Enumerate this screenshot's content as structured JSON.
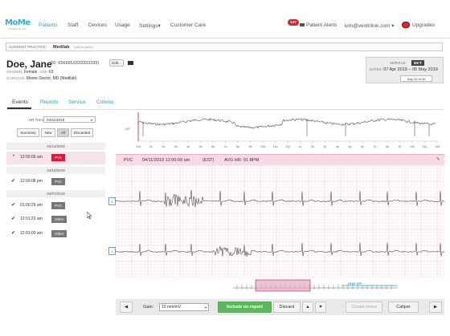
{
  "nav": {
    "logo": "MoMe",
    "logo_sub": "INFOBIONIC INC",
    "items": [
      "Patients",
      "Staff",
      "Devices",
      "Usage",
      "Settings",
      "Customer Care"
    ],
    "settings_caret": "▾",
    "alerts_count": "147",
    "alerts_label": "Patient Alerts",
    "user_email": "kim@ventrilink.com",
    "user_caret": "▾",
    "upgrades_label": "Upgrades"
  },
  "practice": {
    "label": "CURRENT PRACTICE:",
    "value": "Medilab",
    "hint": "(click to switch)"
  },
  "patient": {
    "name": "Doe, Jane",
    "id_text": "(ID: 6566653333333333)",
    "edit_label": "Edit...",
    "gender_label": "GENDER:",
    "gender": "Female",
    "age_label": "AGE:",
    "age": "63",
    "clinician_label": "CLINICIAN:",
    "clinician": "Moore Doctor, MD (Medilab)"
  },
  "service": {
    "label": "SERVICE:",
    "type": "MCT",
    "dates_label": "DATES:",
    "dates": "07 Apr 2019 – 05 May 2019",
    "day": "Day 10 of 30"
  },
  "tabs": [
    "Events",
    "Reports",
    "Service",
    "Criteria"
  ],
  "left": {
    "hr_trend_label": "HR Trend:",
    "hr_trend_value": "04/11/2019",
    "filters": [
      "Summary",
      "New",
      "All",
      "Discarded"
    ],
    "groups": [
      {
        "date": "04/11/2019",
        "events": [
          {
            "time": "12:00:09 am",
            "tag": "PVC"
          }
        ]
      },
      {
        "date": "04/10/2019",
        "events": [
          {
            "time": "12:00:08 pm",
            "tag": "PVC"
          }
        ]
      },
      {
        "date": "04/07/2019",
        "events": [
          {
            "time": "01:00:29 am",
            "tag": "PVC"
          },
          {
            "time": "12:01:23 am",
            "tag": "Other"
          },
          {
            "time": "12:01:00 am",
            "tag": "Other"
          }
        ]
      }
    ]
  },
  "trend": {
    "ylabel": "HR",
    "x_ticks": [
      "12a",
      "1a",
      "2a",
      "3a",
      "4a",
      "5a",
      "6a",
      "7a",
      "8a",
      "9a",
      "10a",
      "11a",
      "12p",
      "1p",
      "2p",
      "3p",
      "4p",
      "5p",
      "6p",
      "7p",
      "8p",
      "9p",
      "10p",
      "11p",
      "12a"
    ]
  },
  "strip": {
    "type": "PVC",
    "timestamp": "04/11/2019 12:00:09 am",
    "tz": "(EST)",
    "avg_hr": "AVG HR: 91 BPM",
    "lead1": "1",
    "lead2": "II"
  },
  "scrubber": {
    "lead_off": "LEAD OFF"
  },
  "toolbar": {
    "prev": "◀",
    "gain_label": "Gain:",
    "gain_value": "10 mm/mV",
    "include": "Include on report",
    "discard": "Discard",
    "up": "▲",
    "down": "▼",
    "create": "Create event",
    "caliper": "Caliper",
    "next": "▶"
  },
  "colors": {
    "brand": "#27a3c9",
    "alert": "#d9262f",
    "event_tag": "#d81b3c",
    "ecg_grid": "#f3c4cf",
    "strip_header": "#f8d9e5",
    "include": "#5cb85c"
  }
}
